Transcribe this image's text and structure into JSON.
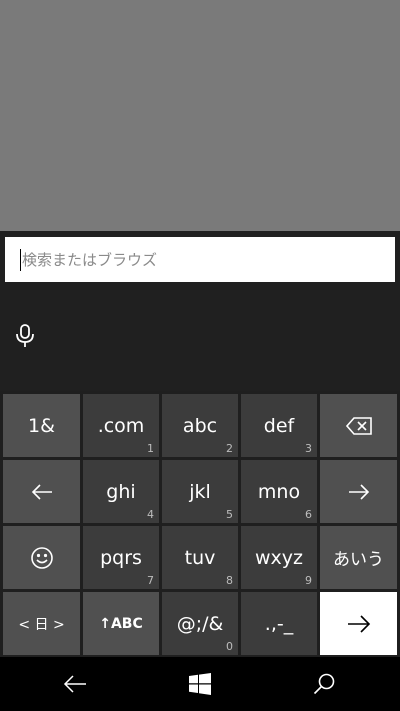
{
  "search": {
    "placeholder": "検索またはブラウズ",
    "value": ""
  },
  "keyboard": {
    "rows": [
      [
        {
          "label": "1&",
          "num": ""
        },
        {
          "label": ".com",
          "num": "1"
        },
        {
          "label": "abc",
          "num": "2"
        },
        {
          "label": "def",
          "num": "3"
        },
        {
          "label": "backspace-icon",
          "num": ""
        }
      ],
      [
        {
          "label": "left-arrow-icon",
          "num": ""
        },
        {
          "label": "ghi",
          "num": "4"
        },
        {
          "label": "jkl",
          "num": "5"
        },
        {
          "label": "mno",
          "num": "6"
        },
        {
          "label": "right-arrow-icon",
          "num": ""
        }
      ],
      [
        {
          "label": "emoji-icon",
          "num": ""
        },
        {
          "label": "pqrs",
          "num": "7"
        },
        {
          "label": "tuv",
          "num": "8"
        },
        {
          "label": "wxyz",
          "num": "9"
        },
        {
          "label": "あいう",
          "num": ""
        }
      ],
      [
        {
          "label": "< 日 >",
          "num": ""
        },
        {
          "label": "↑ABC",
          "num": ""
        },
        {
          "label": "@;/&",
          "num": "0"
        },
        {
          "label": ".,-_",
          "num": ""
        },
        {
          "label": "enter-arrow-icon",
          "num": ""
        }
      ]
    ]
  },
  "colors": {
    "dim": "#7a7a7a",
    "key": "#3c3c3c",
    "key_dark": "#505050",
    "enter": "#ffffff",
    "nav": "#000000"
  },
  "navbar": {
    "icons": [
      "back-icon",
      "windows-icon",
      "search-icon"
    ]
  }
}
